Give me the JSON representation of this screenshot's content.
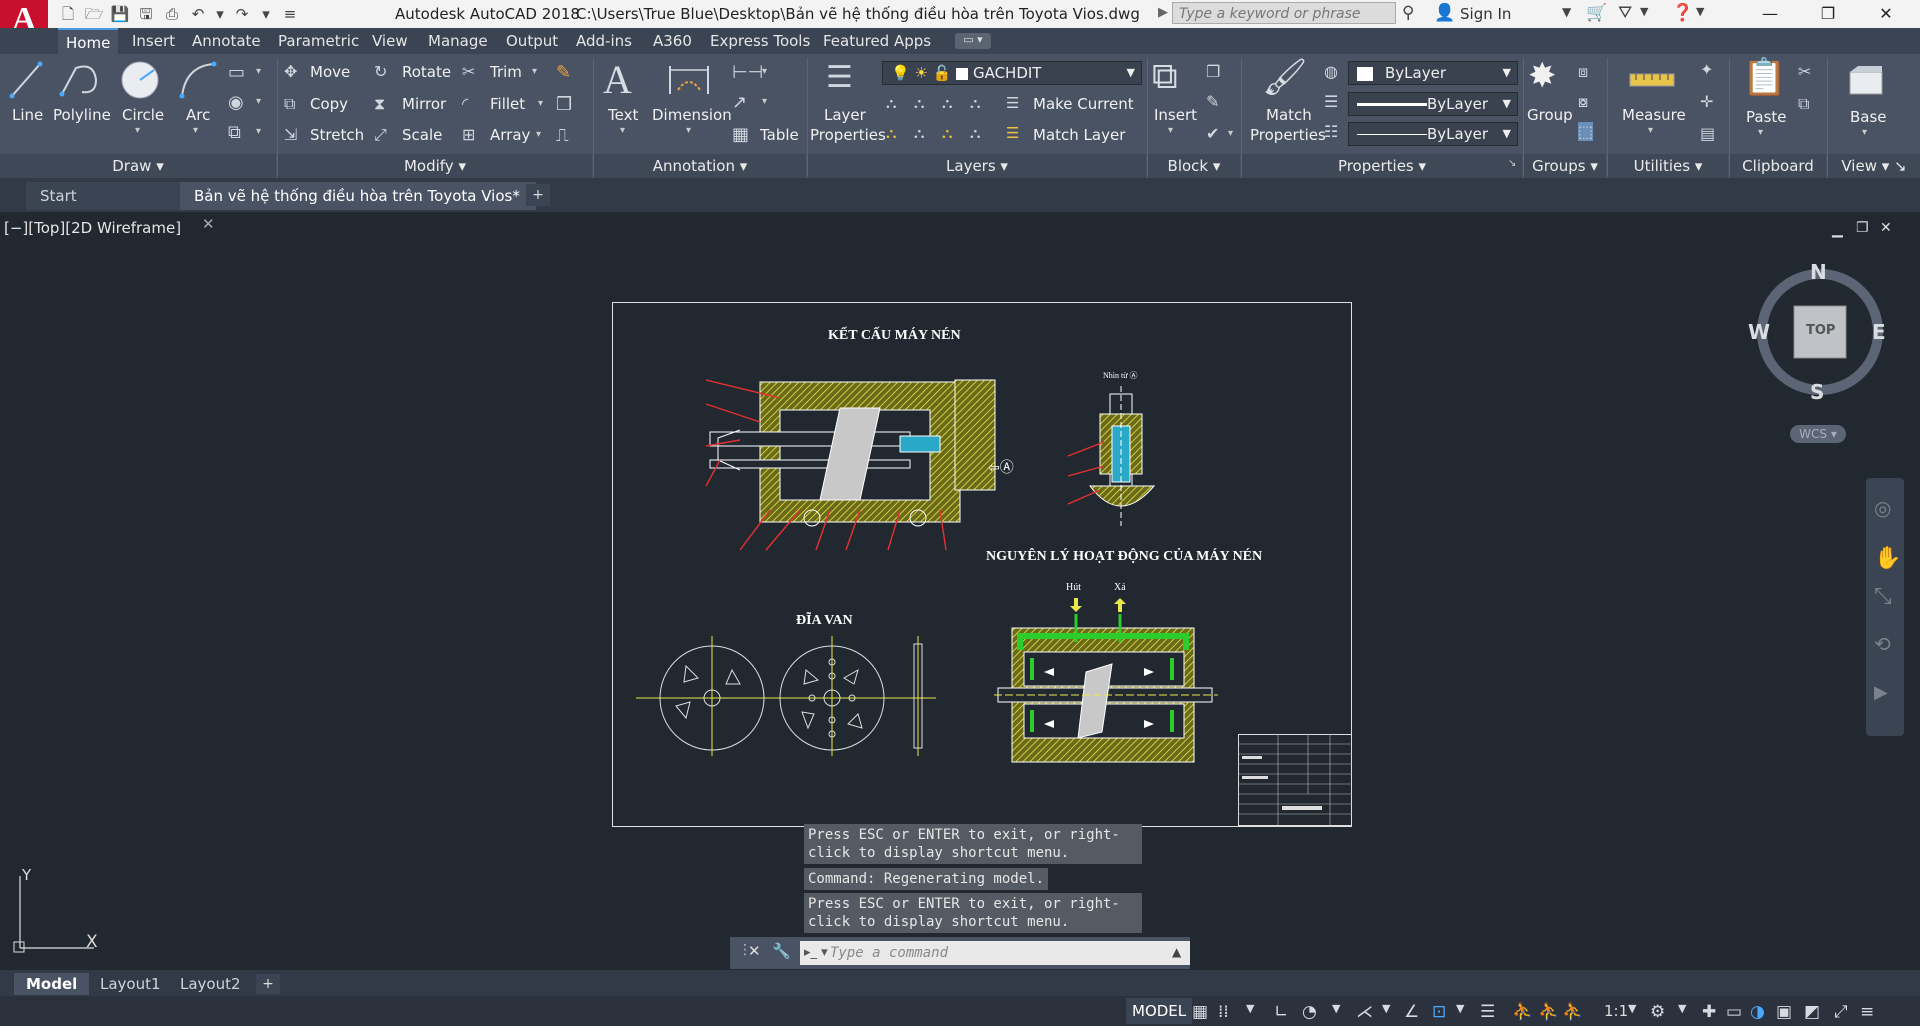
{
  "title_bar": {
    "app": "Autodesk AutoCAD 2018",
    "file_path": "C:\\Users\\True Blue\\Desktop\\Bản vẽ hệ thống điều hòa trên Toyota Vios.dwg",
    "search_placeholder": "Type a keyword or phrase",
    "sign_in": "Sign In"
  },
  "ribbon_tabs": [
    "Home",
    "Insert",
    "Annotate",
    "Parametric",
    "View",
    "Manage",
    "Output",
    "Add-ins",
    "A360",
    "Express Tools",
    "Featured Apps"
  ],
  "draw": {
    "line": "Line",
    "polyline": "Polyline",
    "circle": "Circle",
    "arc": "Arc",
    "title": "Draw"
  },
  "modify": {
    "move": "Move",
    "rotate": "Rotate",
    "trim": "Trim",
    "copy": "Copy",
    "mirror": "Mirror",
    "fillet": "Fillet",
    "stretch": "Stretch",
    "scale": "Scale",
    "array": "Array",
    "title": "Modify"
  },
  "annotation": {
    "text": "Text",
    "dimension": "Dimension",
    "table": "Table",
    "title": "Annotation"
  },
  "layers": {
    "layer_properties_1": "Layer",
    "layer_properties_2": "Properties",
    "current_layer": "GACHDIT",
    "make_current": "Make Current",
    "match_layer": "Match Layer",
    "title": "Layers"
  },
  "block": {
    "insert": "Insert",
    "title": "Block"
  },
  "properties": {
    "match_1": "Match",
    "match_2": "Properties",
    "color": "ByLayer",
    "lineweight": "ByLayer",
    "linetype": "ByLayer",
    "title": "Properties"
  },
  "groups": {
    "group": "Group",
    "title": "Groups"
  },
  "utilities": {
    "measure": "Measure",
    "title": "Utilities"
  },
  "clipboard": {
    "paste": "Paste",
    "title": "Clipboard"
  },
  "view_panel": {
    "base": "Base",
    "title": "View"
  },
  "doc_tabs": [
    "Start",
    "Bản vẽ hệ thống điều hòa trên Toyota Vios*"
  ],
  "viewport_label": "[−][Top][2D Wireframe]",
  "drawing": {
    "title1": "KẾT CẤU MÁY NÉN",
    "title2": "NGUYÊN LÝ HOẠT ĐỘNG CỦA MÁY NÉN",
    "title3": "ĐĨA VAN",
    "arrow_label": "⇦Ⓐ",
    "view_label": "Nhìn từ Ⓐ",
    "hut": "Hút",
    "xa": "Xả"
  },
  "viewcube": {
    "n": "N",
    "s": "S",
    "e": "E",
    "w": "W",
    "top": "TOP",
    "wcs": "WCS"
  },
  "command": {
    "msg1a": "Press ESC or ENTER to exit, or right-",
    "msg1b": "click to display shortcut menu.",
    "msg2": "Command: Regenerating model.",
    "msg3a": "Press ESC or ENTER to exit, or right-",
    "msg3b": "click to display shortcut menu.",
    "placeholder": "Type a command"
  },
  "ucs": {
    "x": "X",
    "y": "Y"
  },
  "layout_tabs": [
    "Model",
    "Layout1",
    "Layout2"
  ],
  "status": {
    "model": "MODEL",
    "scale": "1:1"
  }
}
